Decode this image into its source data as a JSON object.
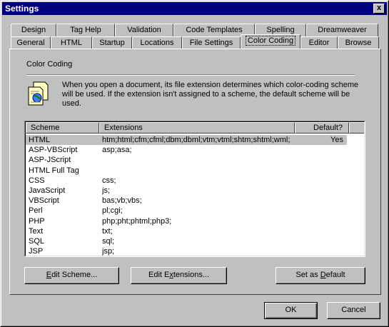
{
  "window": {
    "title": "Settings",
    "close_glyph": "x"
  },
  "tabs": {
    "row_back": [
      {
        "label": "Design"
      },
      {
        "label": "Tag Help"
      },
      {
        "label": "Validation"
      },
      {
        "label": "Code Templates"
      },
      {
        "label": "Spelling"
      },
      {
        "label": "Dreamweaver"
      }
    ],
    "row_front": [
      {
        "label": "General"
      },
      {
        "label": "HTML"
      },
      {
        "label": "Startup"
      },
      {
        "label": "Locations"
      },
      {
        "label": "File Settings"
      },
      {
        "label": "Color Coding",
        "active": true
      },
      {
        "label": "Editor"
      },
      {
        "label": "Browse"
      }
    ]
  },
  "panel": {
    "section_title": "Color Coding",
    "description": "When you open a document, its file extension determines which color-coding scheme will be used.  If the extension isn't assigned to a scheme, the default scheme will be used.",
    "icon": "document-globe-icon"
  },
  "list": {
    "columns": {
      "scheme": "Scheme",
      "extensions": "Extensions",
      "default": "Default?"
    },
    "rows": [
      {
        "scheme": "HTML",
        "extensions": "htm;html;cfm;cfml;dbm;dbml;vtm;vtml;shtm;shtml;wml;",
        "default": "Yes"
      },
      {
        "scheme": "ASP-VBScript",
        "extensions": "asp;asa;",
        "default": ""
      },
      {
        "scheme": "ASP-JScript",
        "extensions": "",
        "default": ""
      },
      {
        "scheme": "HTML Full Tag",
        "extensions": "",
        "default": ""
      },
      {
        "scheme": "CSS",
        "extensions": "css;",
        "default": ""
      },
      {
        "scheme": "JavaScript",
        "extensions": "js;",
        "default": ""
      },
      {
        "scheme": "VBScript",
        "extensions": "bas;vb;vbs;",
        "default": ""
      },
      {
        "scheme": "Perl",
        "extensions": "pl;cgi;",
        "default": ""
      },
      {
        "scheme": "PHP",
        "extensions": "php;pht;phtml;php3;",
        "default": ""
      },
      {
        "scheme": "Text",
        "extensions": "txt;",
        "default": ""
      },
      {
        "scheme": "SQL",
        "extensions": "sql;",
        "default": ""
      },
      {
        "scheme": "JSP",
        "extensions": "jsp;",
        "default": ""
      }
    ],
    "selected_index": 0
  },
  "buttons": {
    "edit_scheme": {
      "pre": "",
      "accel": "E",
      "post": "dit Scheme..."
    },
    "edit_extensions": {
      "pre": "Edit E",
      "accel": "x",
      "post": "tensions..."
    },
    "set_default": {
      "pre": "Set as ",
      "accel": "D",
      "post": "efault"
    },
    "ok": "OK",
    "cancel": "Cancel"
  },
  "colors": {
    "titlebar": "#000080",
    "face": "#c0c0c0",
    "selection": "#c0c0c0"
  }
}
